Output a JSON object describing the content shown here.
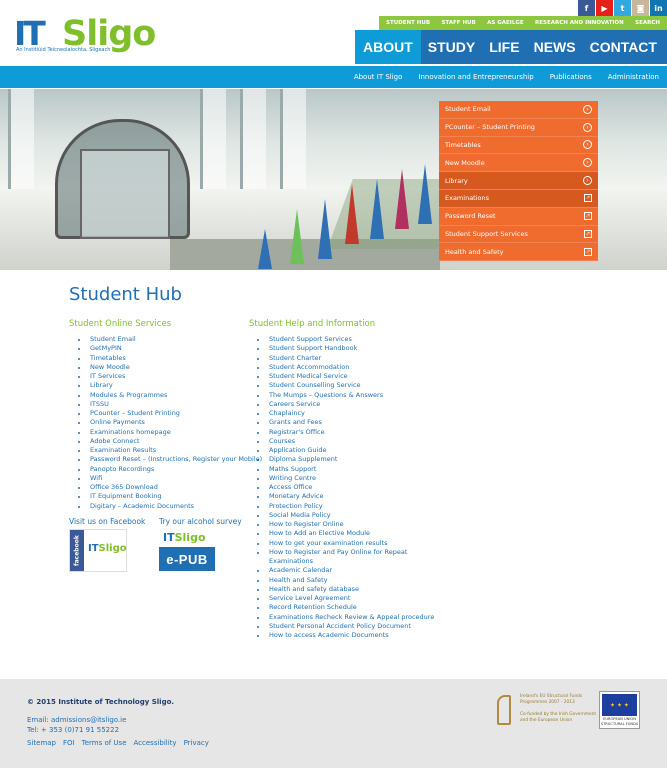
{
  "brand": {
    "logo_it": "IT",
    "logo_sligo": "Sligo",
    "tagline": "An Institiúid Teicneolaíochta, Sligeach"
  },
  "social": [
    {
      "icon": "facebook-icon",
      "glyph": "f",
      "color": "#3b5998"
    },
    {
      "icon": "youtube-icon",
      "glyph": "▶",
      "color": "#e62117"
    },
    {
      "icon": "twitter-icon",
      "glyph": "t",
      "color": "#2fa9e0"
    },
    {
      "icon": "instagram-icon",
      "glyph": "◙",
      "color": "#c9b79c"
    },
    {
      "icon": "linkedin-icon",
      "glyph": "in",
      "color": "#0f76b3"
    }
  ],
  "utility_nav": [
    "Student Hub",
    "Staff Hub",
    "As Gaeilge",
    "Research and Innovation",
    "Search"
  ],
  "main_nav": [
    {
      "label": "ABOUT",
      "active": true
    },
    {
      "label": "STUDY",
      "active": false
    },
    {
      "label": "LIFE",
      "active": false
    },
    {
      "label": "NEWS",
      "active": false
    },
    {
      "label": "CONTACT",
      "active": false
    }
  ],
  "sub_nav": [
    "About IT Sligo",
    "Innovation and Entrepreneurship",
    "Publications",
    "Administration"
  ],
  "quick_links": [
    {
      "label": "Student Email",
      "kind": "arrow"
    },
    {
      "label": "PCounter – Student Printing",
      "kind": "arrow"
    },
    {
      "label": "Timetables",
      "kind": "arrow"
    },
    {
      "label": "New Moodle",
      "kind": "arrow"
    },
    {
      "label": "Library",
      "kind": "arrow"
    },
    {
      "label": "Examinations",
      "kind": "ext"
    },
    {
      "label": "Password Reset",
      "kind": "ext"
    },
    {
      "label": "Student Support Services",
      "kind": "ext"
    },
    {
      "label": "Health and Safety",
      "kind": "ext"
    }
  ],
  "page_title": "Student Hub",
  "online_services": {
    "heading": "Student Online Services",
    "items": [
      "Student Email",
      "GetMyPIN",
      "Timetables",
      "New Moodle",
      "IT Services",
      "Library",
      "Modules & Programmes",
      "ITSSU",
      "PCounter – Student Printing",
      "Online Payments",
      "Examinations homepage",
      "Adobe Connect",
      "Examination Results",
      "Password Reset – (Instructions, Register your Mobile)",
      "Panopto Recordings",
      "Wifi",
      "Office 365 Download",
      "IT Equipment Booking",
      "Digitary – Academic Documents"
    ]
  },
  "help_info": {
    "heading": "Student Help and Information",
    "items": [
      "Student Support Services",
      "Student Support Handbook",
      "Student Charter",
      "Student Accommodation",
      "Student Medical Service",
      "Student Counselling Service",
      "The Mumps – Questions & Answers",
      "Careers Service",
      "Chaplaincy",
      "Grants and Fees",
      "Registrar's Office",
      "Courses",
      "Application Guide",
      "Diploma Supplement",
      "Maths Support",
      "Writing Centre",
      "Access Office",
      "Monetary Advice",
      "Protection Policy",
      "Social Media Policy",
      "How to Register Online",
      "How to Add an Elective Module",
      "How to get your examination results",
      "How to Register and Pay Online for Repeat",
      "Examinations",
      "Academic Calendar",
      "Health and Safety",
      "Health and safety database",
      "Service Level Agreement",
      "Record Retention Schedule",
      "Examinations Recheck Review & Appeal procedure",
      "Student Personal Accident Policy Document",
      "How to access Academic Documents"
    ]
  },
  "facebook": {
    "label": "Visit us on Facebook",
    "badge_side": "facebook"
  },
  "survey": {
    "label": "Try our alcohol survey",
    "badge": "e-PUB"
  },
  "footer": {
    "copyright": "© 2015 Institute of Technology Sligo.",
    "email": "Email: admissions@itsligo.ie",
    "tel": "Tel: + 353 (0)71 91 55222",
    "links": [
      "Sitemap",
      "FOI",
      "Terms of Use",
      "Accessibility",
      "Privacy"
    ],
    "eu_text": [
      "Ireland's EU Structural Funds",
      "Programmes 2007 - 2013",
      "",
      "Co-funded by the Irish Government",
      "and the European Union"
    ],
    "eu_flag_caption": [
      "EUROPEAN UNION",
      "STRUCTURAL FUNDS"
    ]
  }
}
